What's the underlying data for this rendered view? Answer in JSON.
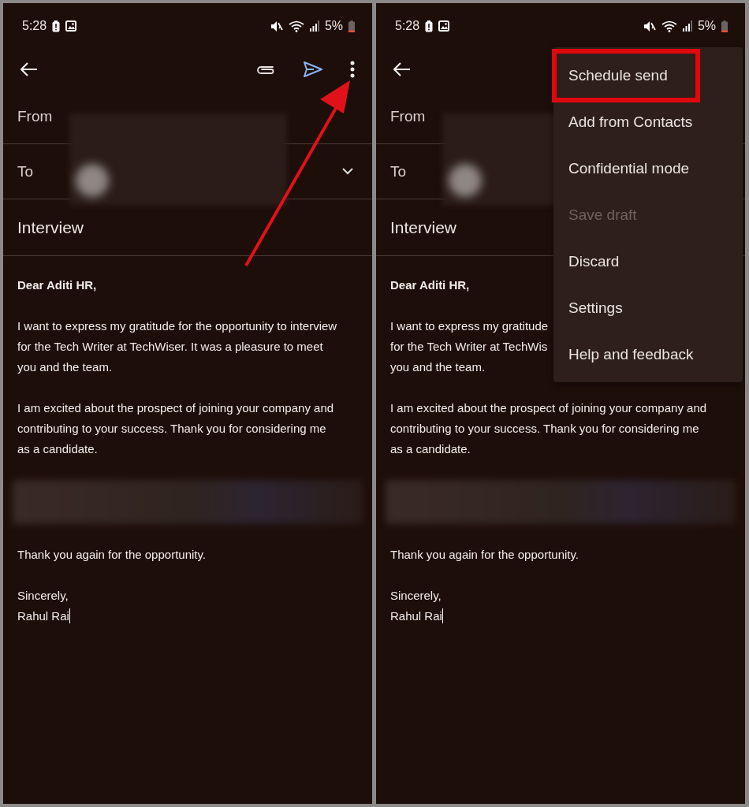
{
  "panels": [
    {
      "status_bar": {
        "time": "5:28",
        "battery": "5%"
      },
      "from_label": "From",
      "to_label": "To",
      "to_expand": true,
      "subject": "Interview",
      "body": [
        {
          "kind": "greeting",
          "lines": [
            "Dear Aditi HR,"
          ]
        },
        {
          "kind": "text",
          "lines": [
            "I want to express my gratitude for the opportunity to interview",
            "for the Tech Writer at TechWiser. It was a pleasure to meet",
            "you and the team."
          ]
        },
        {
          "kind": "text",
          "lines": [
            "I am excited about the prospect of joining your company and",
            "contributing to your success. Thank you for considering me",
            "as a candidate."
          ]
        },
        {
          "kind": "redacted"
        },
        {
          "kind": "text",
          "lines": [
            "Thank you again for the opportunity."
          ]
        },
        {
          "kind": "signature",
          "cursor": true,
          "lines": [
            "Sincerely,",
            "Rahul Rai"
          ]
        }
      ],
      "annotation": {
        "kind": "arrow"
      }
    },
    {
      "status_bar": {
        "time": "5:28",
        "battery": "5%"
      },
      "from_label": "From",
      "to_label": "To",
      "subject": "Interview",
      "body": [
        {
          "kind": "greeting",
          "lines": [
            "Dear Aditi HR,"
          ]
        },
        {
          "kind": "text",
          "lines": [
            "I want to express my gratitude",
            "for the Tech Writer at TechWis",
            "you and the team."
          ]
        },
        {
          "kind": "text",
          "lines": [
            "I am excited about the prospect of joining your company and",
            "contributing to your success. Thank you for considering me",
            "as a candidate."
          ]
        },
        {
          "kind": "redacted"
        },
        {
          "kind": "text",
          "lines": [
            "Thank you again for the opportunity."
          ]
        },
        {
          "kind": "signature",
          "cursor": true,
          "lines": [
            "Sincerely,",
            "Rahul Rai"
          ]
        }
      ],
      "menu": [
        {
          "label": "Schedule send",
          "disabled": false,
          "highlighted": true
        },
        {
          "label": "Add from Contacts",
          "disabled": false,
          "highlighted": false
        },
        {
          "label": "Confidential mode",
          "disabled": false,
          "highlighted": false
        },
        {
          "label": "Save draft",
          "disabled": true,
          "highlighted": false
        },
        {
          "label": "Discard",
          "disabled": false,
          "highlighted": false
        },
        {
          "label": "Settings",
          "disabled": false,
          "highlighted": false
        },
        {
          "label": "Help and feedback",
          "disabled": false,
          "highlighted": false
        }
      ]
    }
  ]
}
